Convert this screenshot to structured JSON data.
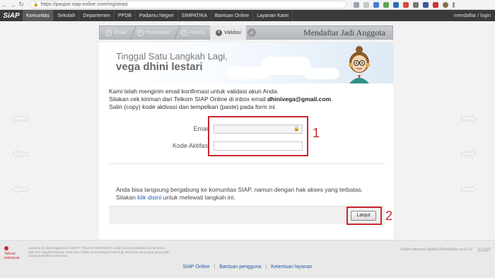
{
  "browser": {
    "back": "←",
    "forward": "→",
    "reload": "↻",
    "url": "https://paspor.siap-online.com/registrasi"
  },
  "sitenav": {
    "logo": "SiAP",
    "items": [
      "Komunitas",
      "Sekolah",
      "Departemen",
      "PPDB",
      "Padamu Negeri",
      "SIMPATIKA",
      "Bantuan Online",
      "Layanan Kami"
    ],
    "right": "mendaftar / login"
  },
  "steps": {
    "items": [
      {
        "num": "1",
        "label": "Email"
      },
      {
        "num": "2",
        "label": "Perkenalan"
      },
      {
        "num": "3",
        "label": "Profesi"
      },
      {
        "num": "4",
        "label": "Validasi"
      }
    ],
    "check": "✓",
    "page_title": "Mendaftar Jadi Anggota"
  },
  "hero": {
    "line1": "Tinggal Satu Langkah Lagi,",
    "line2": "vega dhini lestari"
  },
  "message": {
    "line1": "Kami telah mengirim email konfirmasi untuk validasi akun Anda.",
    "line2_pre": "Silakan cek kiriman dari Telkom SIAP Online di inbox email ",
    "email": "dhinivega@gmail.com",
    "line2_post": ".",
    "line3": "Salin (copy) kode aktivasi dan tempelkan (paste) pada form ini."
  },
  "form": {
    "email_label": "Email",
    "code_label": "Kode Aktifasi"
  },
  "annotations": {
    "one": "1",
    "two": "2"
  },
  "note": {
    "line1": "Anda bisa langsung bergabung ke komunitas SIAP, namun dengan hak akses yang terbatas.",
    "line2_pre": "Silakan ",
    "link": "klik disini",
    "line2_post": " untuk melewati langkah ini."
  },
  "actions": {
    "next": "Lanjut"
  },
  "footer": {
    "logo_text": "Telkom Indonesia",
    "left_note": "Layanan ini diselenggarakan oleh PT TELKOM INDONESIA untuk dunia pendidikan di Indonesia. Mari kita majukan bangsa Indonesia melalui pemanfaatan Teknologi Informasi yang tepat guna pada dunia pendidikan Indonesia.",
    "right_note": "Sistem Informasi Aplikasi Pendidikan versi 2.0",
    "siap_mark": "SiAP",
    "links": [
      "SIAP Online",
      "Bantuan pengguna",
      "Ketentuan layanan"
    ],
    "link_sep": "|"
  },
  "colors": {
    "nav_bg": "#3a3a3a",
    "annotation_red": "#c9272c",
    "link_blue": "#1f5fb5"
  }
}
